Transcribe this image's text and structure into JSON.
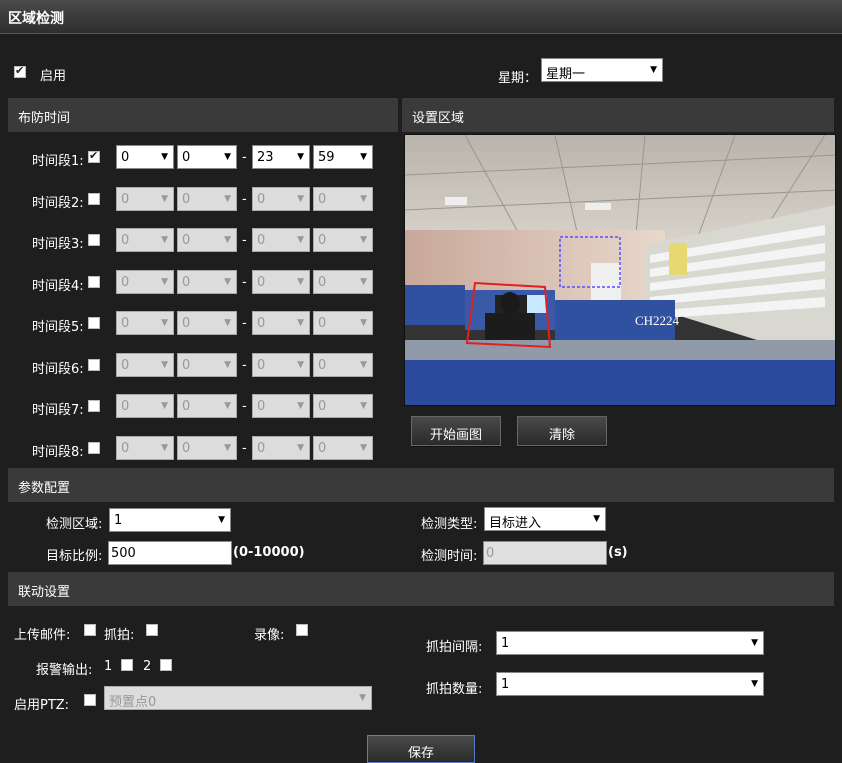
{
  "title": "区域检测",
  "enable": {
    "label": "启用",
    "checked": true
  },
  "week": {
    "label": "星期：",
    "value": "星期一"
  },
  "schedule": {
    "header": "布防时间",
    "segments": [
      {
        "label": "时间段1:",
        "checked": true,
        "sh": "0",
        "sm": "0",
        "eh": "23",
        "em": "59",
        "enabled": true
      },
      {
        "label": "时间段2:",
        "checked": false,
        "sh": "0",
        "sm": "0",
        "eh": "0",
        "em": "0",
        "enabled": false
      },
      {
        "label": "时间段3:",
        "checked": false,
        "sh": "0",
        "sm": "0",
        "eh": "0",
        "em": "0",
        "enabled": false
      },
      {
        "label": "时间段4:",
        "checked": false,
        "sh": "0",
        "sm": "0",
        "eh": "0",
        "em": "0",
        "enabled": false
      },
      {
        "label": "时间段5:",
        "checked": false,
        "sh": "0",
        "sm": "0",
        "eh": "0",
        "em": "0",
        "enabled": false
      },
      {
        "label": "时间段6:",
        "checked": false,
        "sh": "0",
        "sm": "0",
        "eh": "0",
        "em": "0",
        "enabled": false
      },
      {
        "label": "时间段7:",
        "checked": false,
        "sh": "0",
        "sm": "0",
        "eh": "0",
        "em": "0",
        "enabled": false
      },
      {
        "label": "时间段8:",
        "checked": false,
        "sh": "0",
        "sm": "0",
        "eh": "0",
        "em": "0",
        "enabled": false
      }
    ],
    "dash": "-"
  },
  "area": {
    "header": "设置区域",
    "camera_label": "CH2224",
    "start_draw": "开始画图",
    "clear": "清除"
  },
  "params": {
    "header": "参数配置",
    "region_label": "检测区域:",
    "region_value": "1",
    "ratio_label": "目标比例:",
    "ratio_value": "500",
    "ratio_range": "(0-10000)",
    "type_label": "检测类型:",
    "type_value": "目标进入",
    "time_label": "检测时间:",
    "time_value": "0",
    "time_unit": "(s)"
  },
  "linkage": {
    "header": "联动设置",
    "upload_mail": "上传邮件:",
    "snapshot": "抓拍:",
    "record": "录像:",
    "alarm_out": "报警输出:",
    "alarm1": "1",
    "alarm2": "2",
    "ptz_label": "启用PTZ:",
    "ptz_value": "预置点0",
    "interval_label": "抓拍间隔:",
    "interval_value": "1",
    "count_label": "抓拍数量:",
    "count_value": "1"
  },
  "save": "保存",
  "colors": {
    "bg": "#1e1e1e",
    "section": "#3a3a3a",
    "select_bg": "#ffffff",
    "region_red": "#e02020",
    "region_blue": "#4040ff"
  }
}
